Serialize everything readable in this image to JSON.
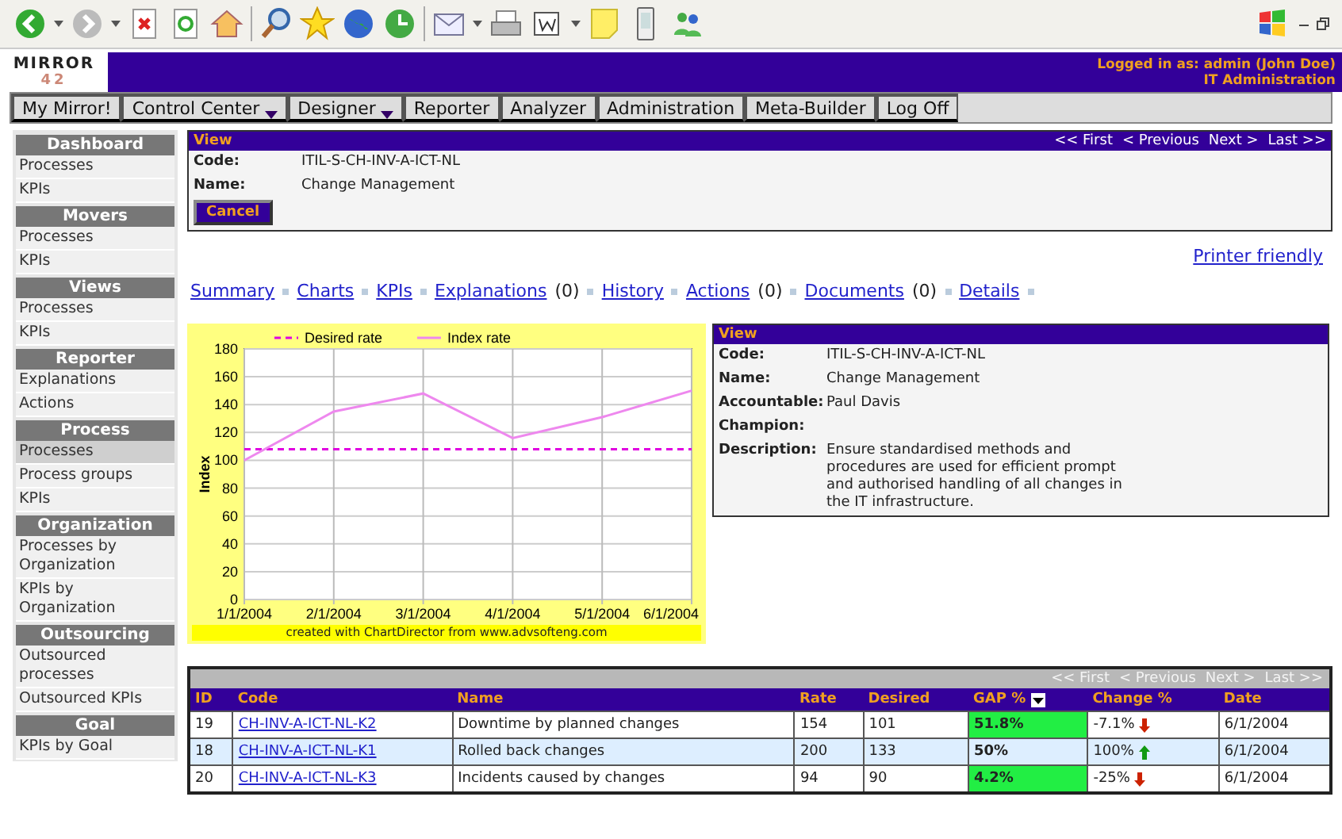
{
  "header": {
    "logo": {
      "line1": "MIRROR",
      "line2": "42"
    },
    "user_info": [
      "Logged in as: admin (John Doe)",
      "IT Administration"
    ]
  },
  "menu": [
    {
      "label": "My Mirror!",
      "dropdown": false
    },
    {
      "label": "Control Center",
      "dropdown": true
    },
    {
      "label": "Designer",
      "dropdown": true
    },
    {
      "label": "Reporter",
      "dropdown": false
    },
    {
      "label": "Analyzer",
      "dropdown": false
    },
    {
      "label": "Administration",
      "dropdown": false
    },
    {
      "label": "Meta-Builder",
      "dropdown": false
    },
    {
      "label": "Log Off",
      "dropdown": false
    }
  ],
  "sidebar": {
    "sections": [
      {
        "title": "Dashboard",
        "items": [
          {
            "label": "Processes",
            "selected": false
          },
          {
            "label": "KPIs",
            "selected": false
          }
        ]
      },
      {
        "title": "Movers",
        "items": [
          {
            "label": "Processes",
            "selected": false
          },
          {
            "label": "KPIs",
            "selected": false
          }
        ]
      },
      {
        "title": "Views",
        "items": [
          {
            "label": "Processes",
            "selected": false
          },
          {
            "label": "KPIs",
            "selected": false
          }
        ]
      },
      {
        "title": "Reporter",
        "items": [
          {
            "label": "Explanations",
            "selected": false
          },
          {
            "label": "Actions",
            "selected": false
          }
        ]
      },
      {
        "title": "Process",
        "items": [
          {
            "label": "Processes",
            "selected": true
          },
          {
            "label": "Process groups",
            "selected": false
          },
          {
            "label": "KPIs",
            "selected": false
          }
        ]
      },
      {
        "title": "Organization",
        "items": [
          {
            "label": "Processes by Organization",
            "selected": false
          },
          {
            "label": "KPIs by Organization",
            "selected": false
          }
        ]
      },
      {
        "title": "Outsourcing",
        "items": [
          {
            "label": "Outsourced processes",
            "selected": false
          },
          {
            "label": "Outsourced KPIs",
            "selected": false
          }
        ]
      },
      {
        "title": "Goal",
        "items": [
          {
            "label": "KPIs by Goal",
            "selected": false
          }
        ]
      }
    ]
  },
  "view_panel": {
    "title": "View",
    "pager": [
      {
        "label": "<< First"
      },
      {
        "label": "< Previous"
      },
      {
        "label": "Next >"
      },
      {
        "label": "Last >>"
      }
    ],
    "fields": [
      {
        "label": "Code:",
        "value": "ITIL-S-CH-INV-A-ICT-NL"
      },
      {
        "label": "Name:",
        "value": "Change Management"
      }
    ],
    "cancel_button": "Cancel"
  },
  "printer_link": "Printer friendly",
  "section_links": [
    {
      "label": "Summary"
    },
    {
      "label": "Charts"
    },
    {
      "label": "KPIs"
    },
    {
      "label": "Explanations",
      "count": "(0)"
    },
    {
      "label": "History"
    },
    {
      "label": "Actions",
      "count": "(0)"
    },
    {
      "label": "Documents",
      "count": "(0)"
    },
    {
      "label": "Details"
    }
  ],
  "chart": {
    "footer": "created with ChartDirector from www.advsofteng.com",
    "chart_data": {
      "type": "line",
      "ylabel": "Index",
      "x": [
        "1/1/2004",
        "2/1/2004",
        "3/1/2004",
        "4/1/2004",
        "5/1/2004",
        "6/1/2004"
      ],
      "grid": true,
      "legend": true,
      "series": [
        {
          "name": "Desired rate",
          "color": "#e000e0",
          "line_style": "dashed",
          "values": [
            108,
            108,
            108,
            108,
            108,
            108
          ]
        },
        {
          "name": "Index rate",
          "color": "#ee88ee",
          "line_style": "solid",
          "values": [
            100,
            135,
            148,
            116,
            131,
            150
          ]
        }
      ],
      "ylim": [
        0,
        180
      ],
      "yticks": [
        {
          "value": 0,
          "label": "0"
        },
        {
          "value": 20,
          "label": "20"
        },
        {
          "value": 40,
          "label": "40"
        },
        {
          "value": 60,
          "label": "60"
        },
        {
          "value": 80,
          "label": "80"
        },
        {
          "value": 100,
          "label": "100"
        },
        {
          "value": 120,
          "label": "120"
        },
        {
          "value": 140,
          "label": "140"
        },
        {
          "value": 160,
          "label": "160"
        },
        {
          "value": 180,
          "label": "180"
        }
      ]
    }
  },
  "detail_panel": {
    "title": "View",
    "fields": [
      {
        "label": "Code:",
        "value": "ITIL-S-CH-INV-A-ICT-NL"
      },
      {
        "label": "Name:",
        "value": "Change Management"
      },
      {
        "label": "Accountable:",
        "value": "Paul Davis"
      },
      {
        "label": "Champion:"
      },
      {
        "label": "Description:",
        "value": "Ensure standardised methods and procedures are used for efficient prompt and authorised handling of all changes in the IT infrastructure."
      }
    ]
  },
  "kpi_table": {
    "pager": [
      {
        "label": "<< First",
        "disabled": true
      },
      {
        "label": "< Previous",
        "disabled": true
      },
      {
        "label": "Next >",
        "disabled": true
      },
      {
        "label": "Last >>",
        "disabled": true
      }
    ],
    "columns": [
      {
        "label": "ID",
        "sorted": false
      },
      {
        "label": "Code",
        "sorted": false
      },
      {
        "label": "Name",
        "sorted": false
      },
      {
        "label": "Rate",
        "sorted": false
      },
      {
        "label": "Desired",
        "sorted": false
      },
      {
        "label": "GAP %",
        "sorted": true
      },
      {
        "label": "Change %",
        "sorted": false
      },
      {
        "label": "Date",
        "sorted": false
      }
    ],
    "rows": [
      {
        "id": "19",
        "code": "CH-INV-A-ICT-NL-K2",
        "name": "Downtime by planned changes",
        "rate": "154",
        "desired": "101",
        "gap": "51.8%",
        "change": "-7.1%",
        "rising": false,
        "date": "6/1/2004",
        "selected": false
      },
      {
        "id": "18",
        "code": "CH-INV-A-ICT-NL-K1",
        "name": "Rolled back changes",
        "rate": "200",
        "desired": "133",
        "gap": "50%",
        "change": "100%",
        "rising": true,
        "date": "6/1/2004",
        "selected": true
      },
      {
        "id": "20",
        "code": "CH-INV-A-ICT-NL-K3",
        "name": "Incidents caused by changes",
        "rate": "94",
        "desired": "90",
        "gap": "4.2%",
        "change": "-25%",
        "rising": false,
        "date": "6/1/2004",
        "selected": false
      }
    ]
  }
}
